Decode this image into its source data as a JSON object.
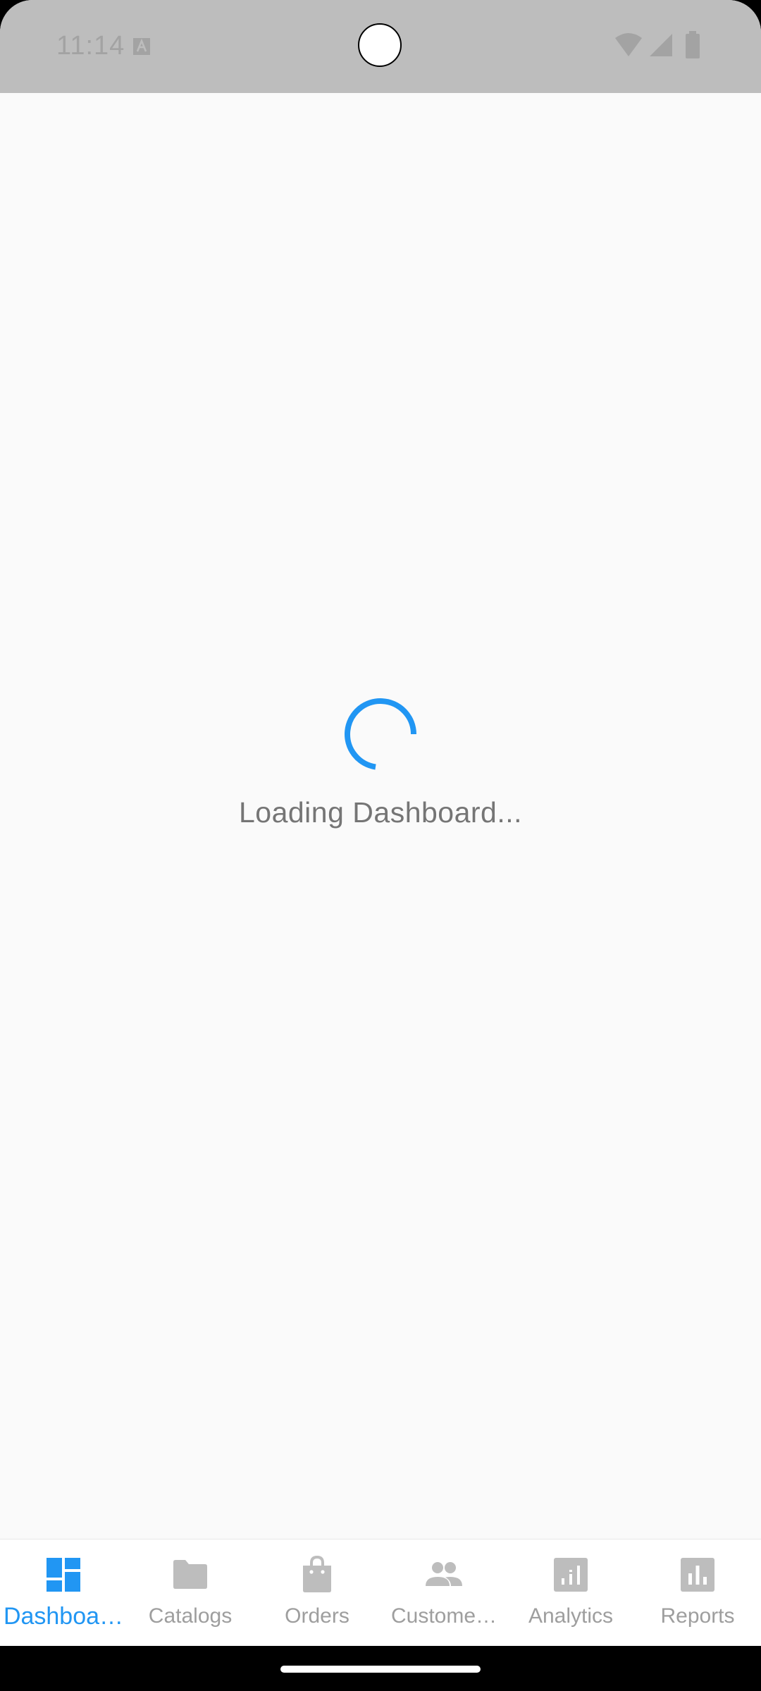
{
  "status_bar": {
    "time": "11:14",
    "icons": [
      "keyboard-a-icon",
      "wifi-icon",
      "cell-signal-icon",
      "battery-icon"
    ]
  },
  "loading": {
    "text": "Loading Dashboard...",
    "spinner_color": "#2196f3"
  },
  "bottom_nav": {
    "items": [
      {
        "label": "Dashboa…",
        "icon": "dashboard-icon",
        "active": true
      },
      {
        "label": "Catalogs",
        "icon": "folder-icon",
        "active": false
      },
      {
        "label": "Orders",
        "icon": "shopping-bag-icon",
        "active": false
      },
      {
        "label": "Custome…",
        "icon": "people-icon",
        "active": false
      },
      {
        "label": "Analytics",
        "icon": "analytics-icon",
        "active": false
      },
      {
        "label": "Reports",
        "icon": "bar-chart-icon",
        "active": false
      }
    ],
    "active_color": "#2196f3",
    "inactive_color": "#bdbdbd"
  }
}
